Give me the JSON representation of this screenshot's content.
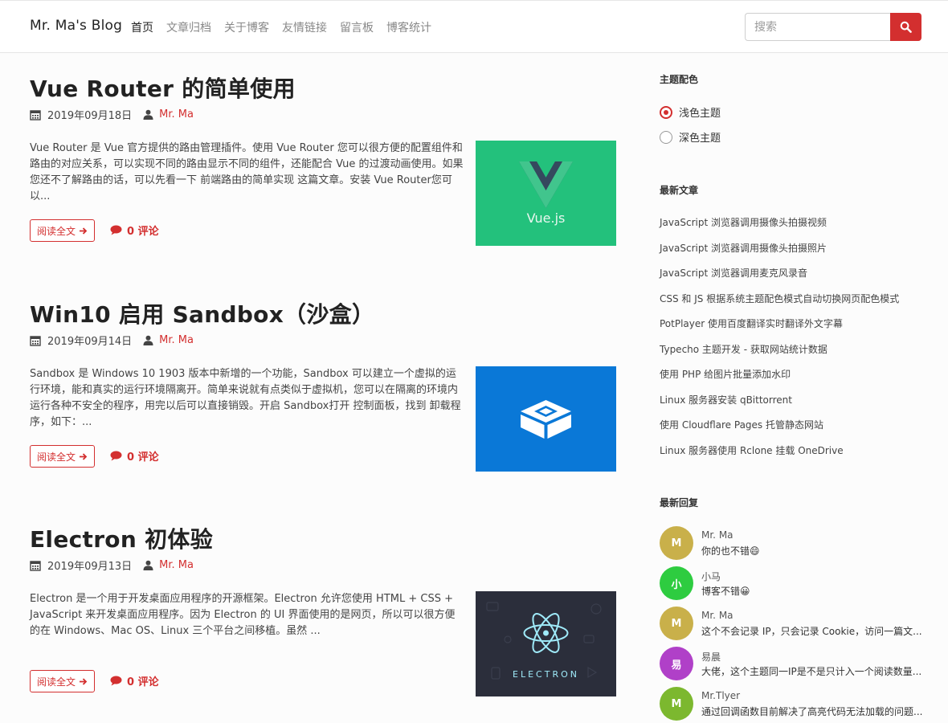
{
  "header": {
    "brand": "Mr. Ma's Blog",
    "nav": [
      "首页",
      "文章归档",
      "关于博客",
      "友情链接",
      "留言板",
      "博客统计"
    ],
    "search_placeholder": "搜索"
  },
  "posts": [
    {
      "title": "Vue Router 的简单使用",
      "date": "2019年09月18日",
      "author": "Mr. Ma",
      "excerpt": "Vue Router 是 Vue 官方提供的路由管理插件。使用 Vue Router 您可以很方便的配置组件和路由的对应关系，可以实现不同的路由显示不同的组件，还能配合 Vue 的过渡动画使用。如果您还不了解路由的话，可以先看一下 前端路由的简单实现 这篇文章。安装 Vue Router您可以...",
      "read_more": "阅读全文",
      "comments": "0 评论",
      "thumb_text": "Vue.js"
    },
    {
      "title": "Win10 启用 Sandbox（沙盒）",
      "date": "2019年09月14日",
      "author": "Mr. Ma",
      "excerpt": "Sandbox 是 Windows 10 1903 版本中新增的一个功能，Sandbox 可以建立一个虚拟的运行环境，能和真实的运行环境隔离开。简单来说就有点类似于虚拟机，您可以在隔离的环境内运行各种不安全的程序，用完以后可以直接销毁。开启 Sandbox打开 控制面板，找到 卸载程序，如下：...",
      "read_more": "阅读全文",
      "comments": "0 评论"
    },
    {
      "title": "Electron 初体验",
      "date": "2019年09月13日",
      "author": "Mr. Ma",
      "excerpt": "Electron 是一个用于开发桌面应用程序的开源框架。Electron 允许您使用 HTML + CSS + JavaScript 来开发桌面应用程序。因为 Electron 的 UI 界面使用的是网页，所以可以很方便的在 Windows、Mac OS、Linux 三个平台之间移植。虽然 ...",
      "read_more": "阅读全文",
      "comments": "0 评论",
      "thumb_text": "ELECTRON"
    }
  ],
  "sidebar": {
    "theme_heading": "主题配色",
    "theme_options": [
      "浅色主题",
      "深色主题"
    ],
    "theme_selected": "浅色主题",
    "recent_heading": "最新文章",
    "recent_posts": [
      "JavaScript 浏览器调用摄像头拍摄视频",
      "JavaScript 浏览器调用摄像头拍摄照片",
      "JavaScript 浏览器调用麦克风录音",
      "CSS 和 JS 根据系统主题配色模式自动切换网页配色模式",
      "PotPlayer 使用百度翻译实时翻译外文字幕",
      "Typecho 主题开发 - 获取网站统计数据",
      "使用 PHP 给图片批量添加水印",
      "Linux 服务器安装 qBittorrent",
      "使用 Cloudflare Pages 托管静态网站",
      "Linux 服务器使用 Rclone 挂载 OneDrive"
    ],
    "replies_heading": "最新回复",
    "replies": [
      {
        "initial": "M",
        "name": "Mr. Ma",
        "text": "你的也不错😄",
        "color": "#c9b04a"
      },
      {
        "initial": "小",
        "name": "小马",
        "text": "博客不错😀",
        "color": "#2ecc40"
      },
      {
        "initial": "M",
        "name": "Mr. Ma",
        "text": "这个不会记录 IP，只会记录 Cookie，访问一篇文...",
        "color": "#c9b04a"
      },
      {
        "initial": "易",
        "name": "易晨",
        "text": "大佬，这个主题同一IP是不是只计入一个阅读数量...",
        "color": "#b040c8"
      },
      {
        "initial": "M",
        "name": "Mr.Tlyer",
        "text": "通过回调函数目前解决了高亮代码无法加载的问题...",
        "color": "#7cb82f"
      }
    ]
  },
  "colors": {
    "accent": "#d32f2f",
    "vue_bg": "#23c17c",
    "sandbox_bg": "#0a78d7",
    "electron_bg": "#2b2e3b"
  }
}
